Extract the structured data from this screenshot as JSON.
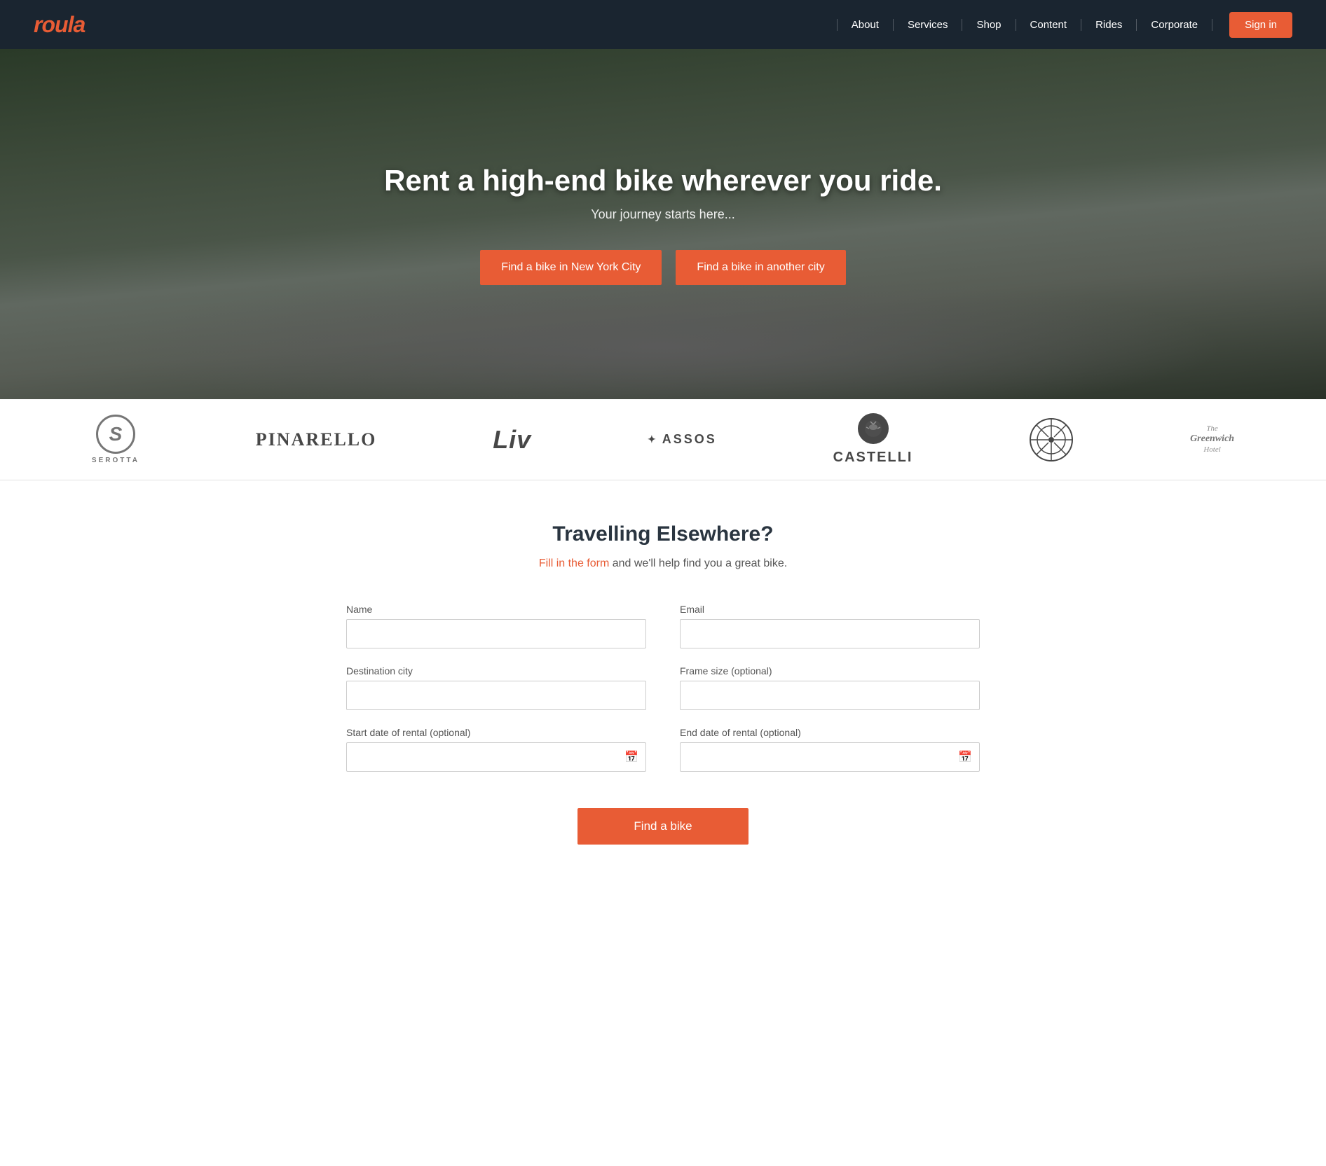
{
  "brand": {
    "logo": "roula"
  },
  "nav": {
    "links": [
      {
        "id": "about",
        "label": "About"
      },
      {
        "id": "services",
        "label": "Services"
      },
      {
        "id": "shop",
        "label": "Shop"
      },
      {
        "id": "content",
        "label": "Content"
      },
      {
        "id": "rides",
        "label": "Rides"
      },
      {
        "id": "corporate",
        "label": "Corporate"
      }
    ],
    "signin_label": "Sign in"
  },
  "hero": {
    "title": "Rent a high-end bike wherever you ride.",
    "subtitle": "Your journey starts here...",
    "btn_nyc": "Find a bike in New York City",
    "btn_other": "Find a bike in another city"
  },
  "brands": [
    {
      "id": "serotta",
      "name": "SEROTTA"
    },
    {
      "id": "pinarello",
      "name": "PINARELLO"
    },
    {
      "id": "liv",
      "name": "Liv"
    },
    {
      "id": "assos",
      "name": "ASSOS"
    },
    {
      "id": "castelli",
      "name": "CASTELLI"
    },
    {
      "id": "wheel",
      "name": "wheel-logo"
    },
    {
      "id": "greenwich",
      "name": "The Greenwich Hotel"
    }
  ],
  "form_section": {
    "title": "Travelling Elsewhere?",
    "subtitle_prefix": "Fill in the form",
    "subtitle_suffix": " and we'll help find you a great bike.",
    "subtitle_link": "Fill in the form",
    "fields": {
      "name_label": "Name",
      "email_label": "Email",
      "destination_label": "Destination city",
      "frame_label": "Frame size (optional)",
      "start_label": "Start date of rental (optional)",
      "end_label": "End date of rental (optional)"
    },
    "submit_label": "Find a bike"
  }
}
